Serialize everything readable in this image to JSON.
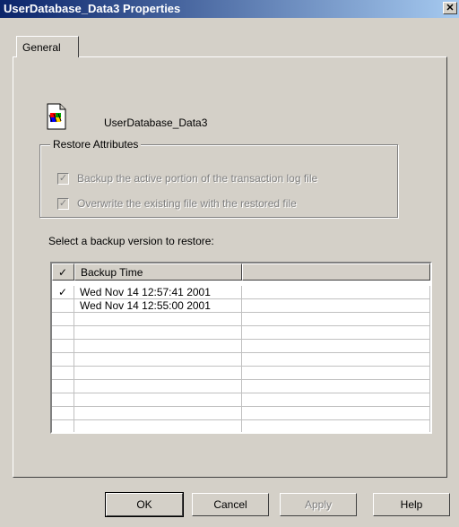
{
  "window": {
    "title": "UserDatabase_Data3 Properties",
    "close_glyph": "✕"
  },
  "tabs": [
    {
      "label": "General",
      "active": true
    }
  ],
  "file": {
    "name": "UserDatabase_Data3",
    "icon": "generic-file-icon"
  },
  "restore_attributes": {
    "group_label": "Restore Attributes",
    "options": [
      {
        "label": "Backup the active portion of the transaction log file",
        "checked": true,
        "enabled": false
      },
      {
        "label": "Overwrite the existing file with the restored file",
        "checked": true,
        "enabled": false
      }
    ]
  },
  "backup_list": {
    "label": "Select a backup version to restore:",
    "columns": [
      "✓",
      "Backup Time",
      ""
    ],
    "rows": [
      {
        "check": "✓",
        "time": "Wed Nov 14 12:57:41 2001",
        "extra": ""
      },
      {
        "check": "",
        "time": "Wed Nov 14 12:55:00 2001",
        "extra": ""
      }
    ]
  },
  "buttons": {
    "ok": "OK",
    "cancel": "Cancel",
    "apply": "Apply",
    "help": "Help"
  },
  "colors": {
    "title_gradient_start": "#0a246a",
    "title_gradient_end": "#a6caf0",
    "face": "#d4d0c8"
  }
}
